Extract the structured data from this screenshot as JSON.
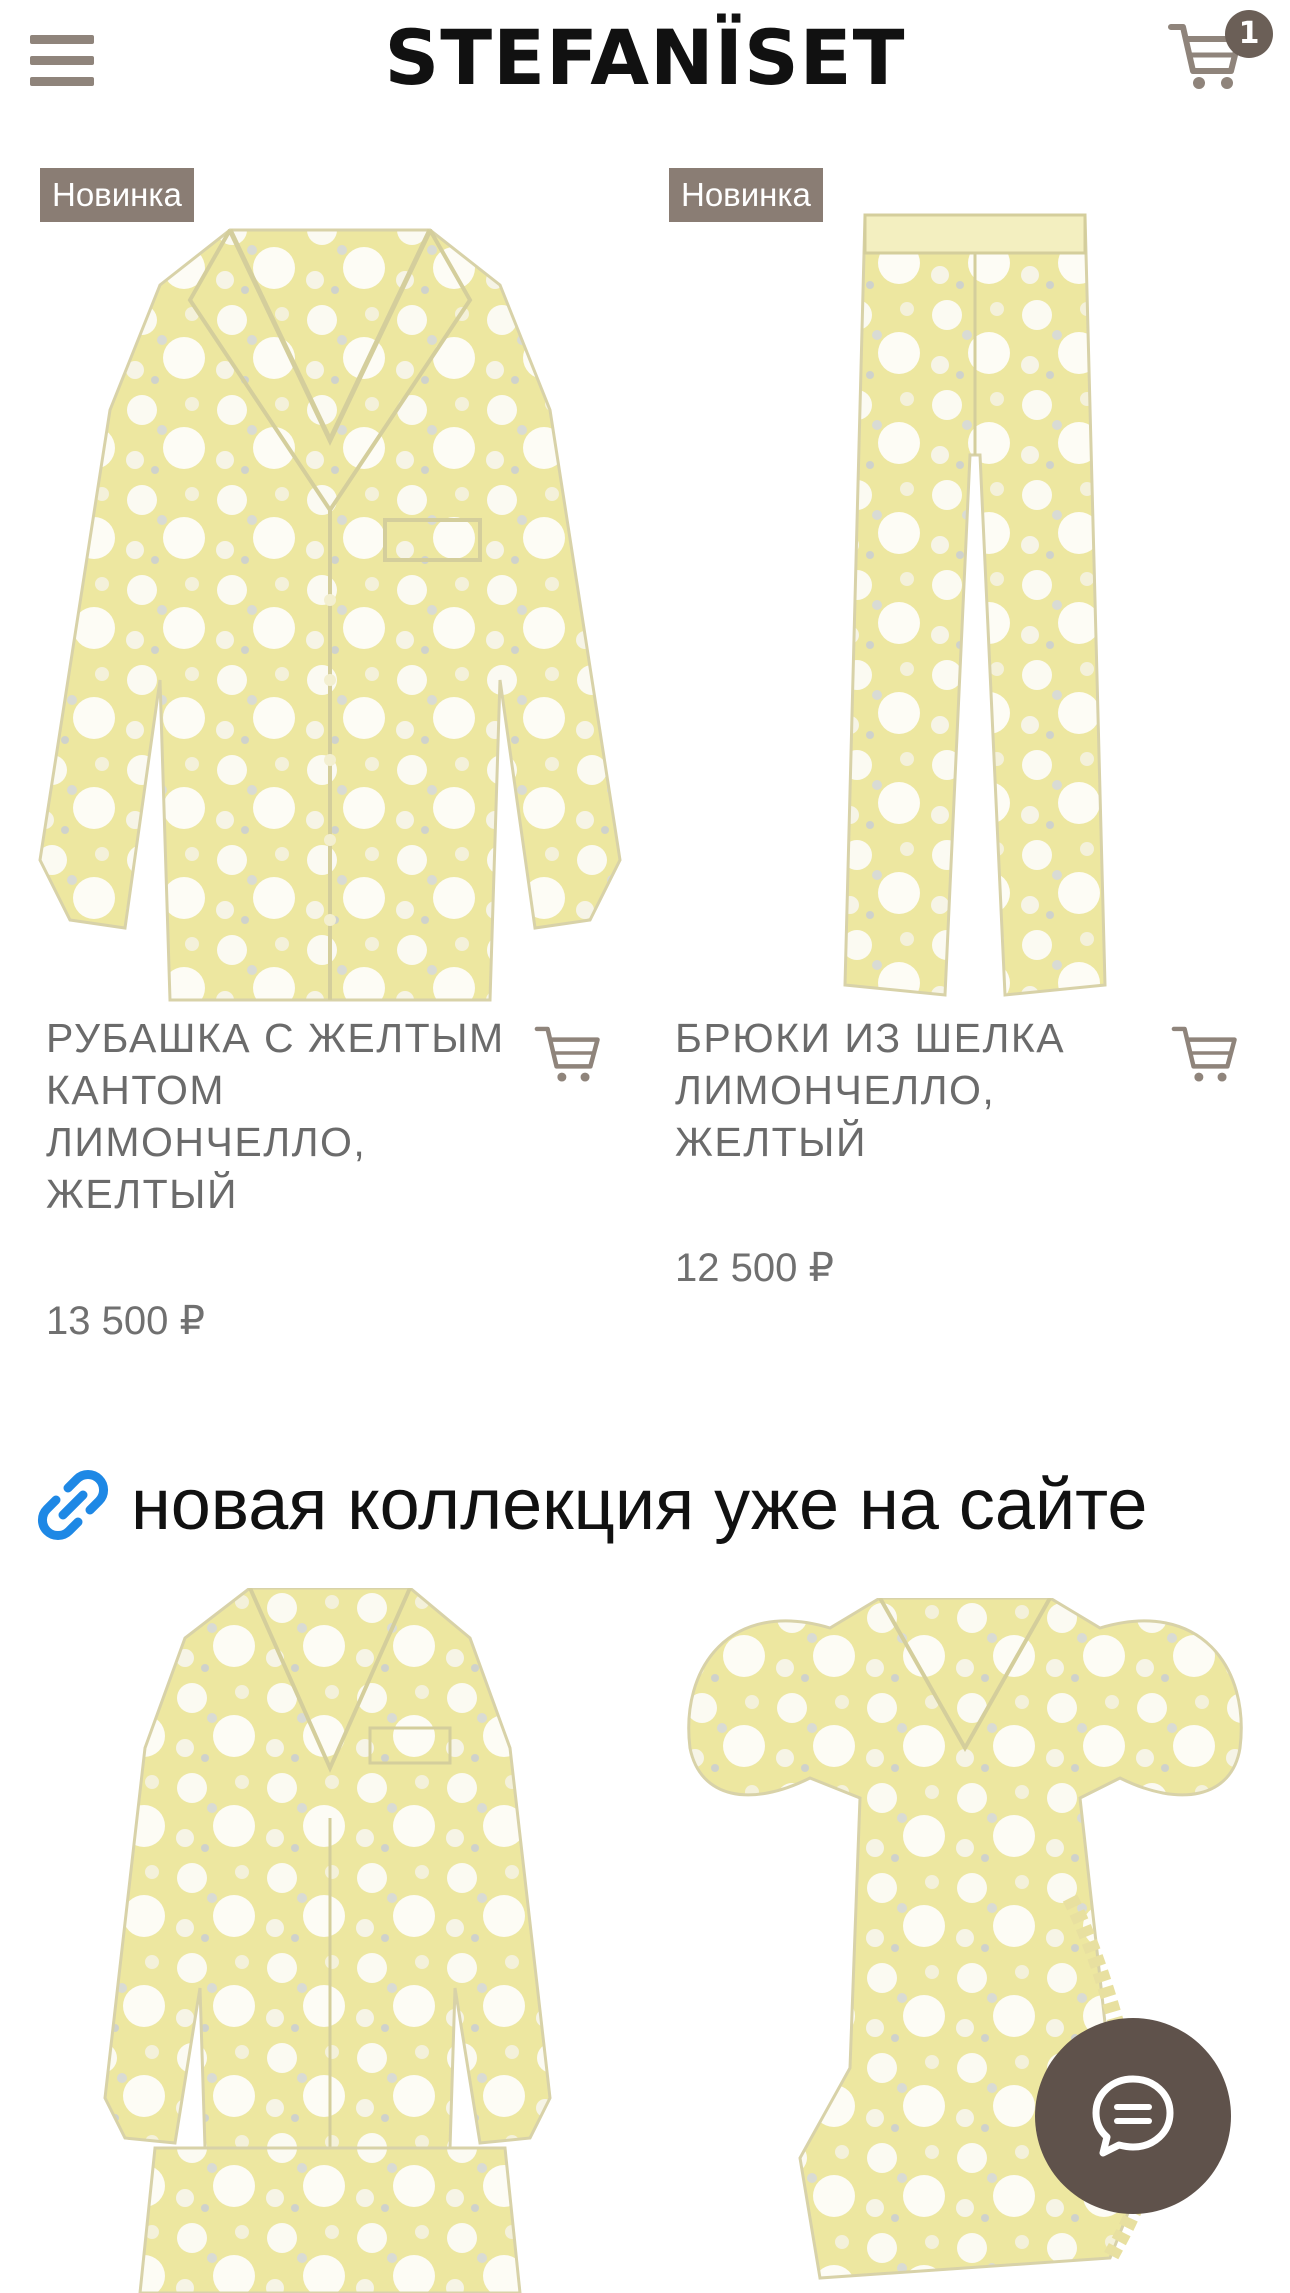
{
  "header": {
    "logo": "STEFANÏSET",
    "cart_count": "1"
  },
  "products": [
    {
      "badge": "Новинка",
      "title": "РУБАШКА С ЖЕЛТЫМ КАНТОМ ЛИМОНЧЕЛЛО, ЖЕЛТЫЙ",
      "price": "13 500 ₽"
    },
    {
      "badge": "Новинка",
      "title": "БРЮКИ ИЗ ШЕЛКА ЛИМОНЧЕЛЛО, ЖЕЛТЫЙ",
      "price": "12 500 ₽"
    }
  ],
  "section": {
    "heading": "новая коллекция уже на сайте"
  },
  "icons": {
    "menu": "hamburger-menu-icon",
    "cart": "shopping-cart-icon",
    "link": "link-icon",
    "chat": "chat-bubble-icon"
  },
  "colors": {
    "badge_bg": "#8a7d74",
    "fabric_yellow": "#ede7a0",
    "chat_button": "#5f524b",
    "link_blue": "#1e88e5"
  }
}
